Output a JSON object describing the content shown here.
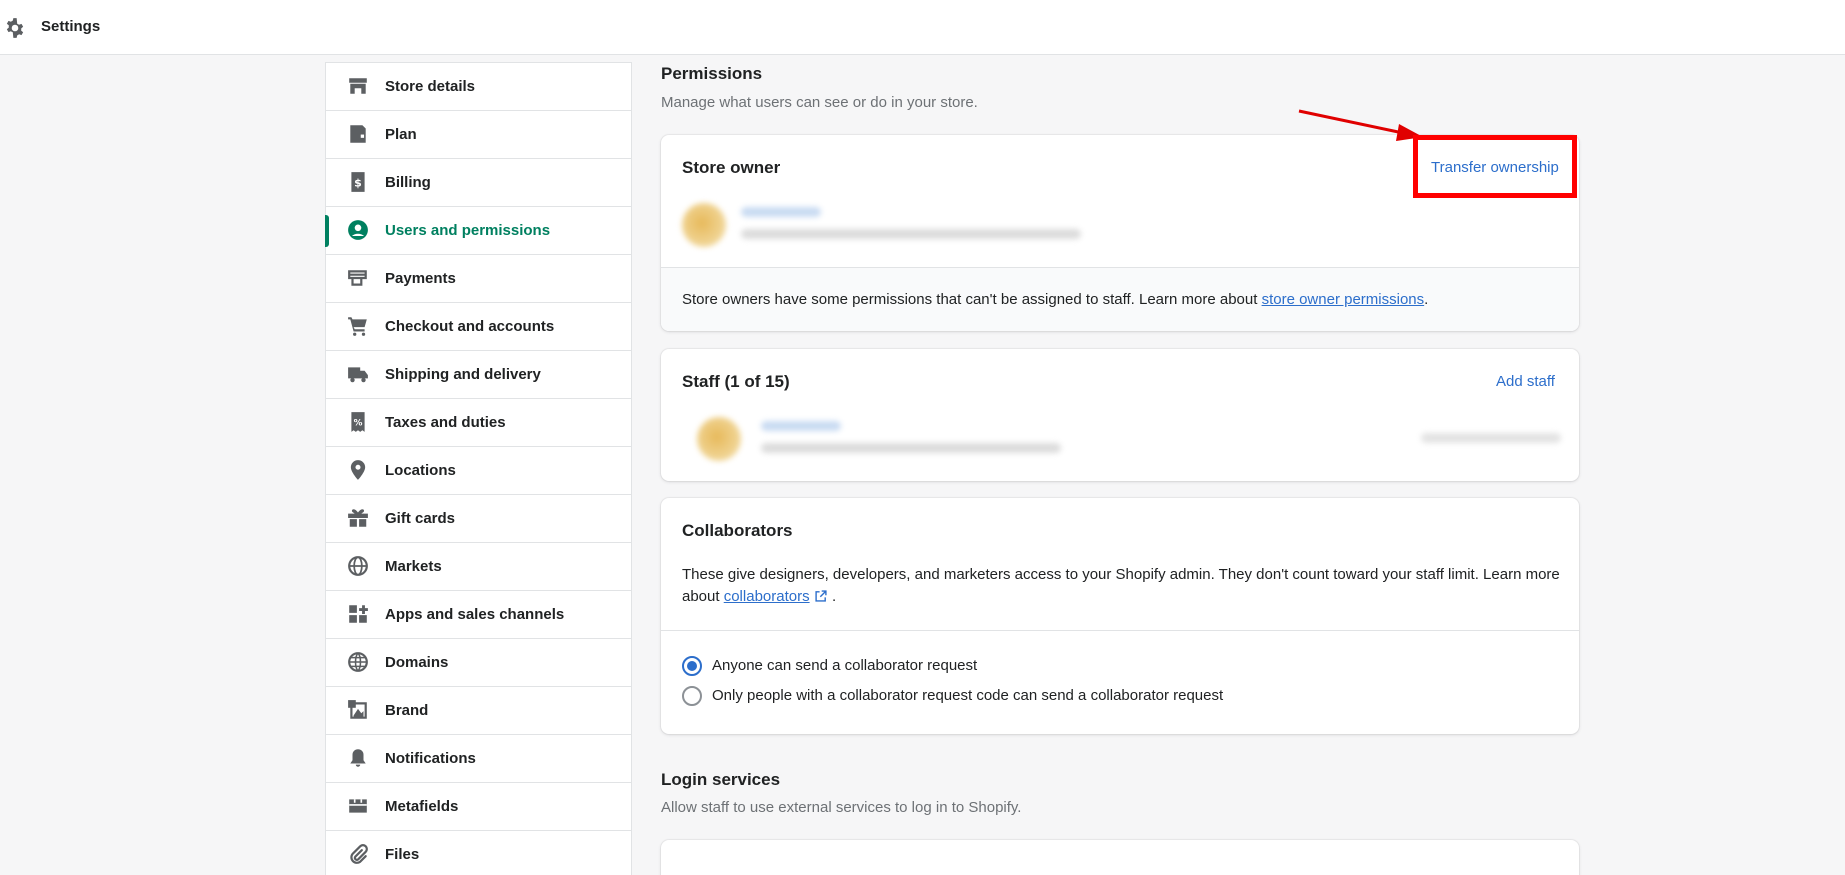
{
  "header": {
    "title": "Settings",
    "icon": "gear-icon"
  },
  "sidebar": {
    "items": [
      {
        "label": "Store details",
        "icon": "store-icon",
        "active": false
      },
      {
        "label": "Plan",
        "icon": "plan-icon",
        "active": false
      },
      {
        "label": "Billing",
        "icon": "billing-icon",
        "active": false
      },
      {
        "label": "Users and permissions",
        "icon": "user-circle-icon",
        "active": true
      },
      {
        "label": "Payments",
        "icon": "payments-icon",
        "active": false
      },
      {
        "label": "Checkout and accounts",
        "icon": "cart-icon",
        "active": false
      },
      {
        "label": "Shipping and delivery",
        "icon": "truck-icon",
        "active": false
      },
      {
        "label": "Taxes and duties",
        "icon": "tax-icon",
        "active": false
      },
      {
        "label": "Locations",
        "icon": "location-pin-icon",
        "active": false
      },
      {
        "label": "Gift cards",
        "icon": "gift-icon",
        "active": false
      },
      {
        "label": "Markets",
        "icon": "globe-markets-icon",
        "active": false
      },
      {
        "label": "Apps and sales channels",
        "icon": "apps-icon",
        "active": false
      },
      {
        "label": "Domains",
        "icon": "globe-icon",
        "active": false
      },
      {
        "label": "Brand",
        "icon": "brand-icon",
        "active": false
      },
      {
        "label": "Notifications",
        "icon": "bell-icon",
        "active": false
      },
      {
        "label": "Metafields",
        "icon": "metafields-icon",
        "active": false
      },
      {
        "label": "Files",
        "icon": "paperclip-icon",
        "active": false
      }
    ]
  },
  "permissions": {
    "title": "Permissions",
    "subtitle": "Manage what users can see or do in your store."
  },
  "store_owner": {
    "title": "Store owner",
    "transfer_label": "Transfer ownership",
    "note_text": "Store owners have some permissions that can't be assigned to staff. Learn more about ",
    "note_link": "store owner permissions",
    "note_end": "."
  },
  "staff": {
    "title": "Staff (1 of 15)",
    "add_label": "Add staff"
  },
  "collaborators": {
    "title": "Collaborators",
    "text": "These give designers, developers, and marketers access to your Shopify admin. They don't count toward your staff limit. Learn more about ",
    "link": "collaborators",
    "text_end": " .",
    "options": [
      {
        "label": "Anyone can send a collaborator request",
        "checked": true
      },
      {
        "label": "Only people with a collaborator request code can send a collaborator request",
        "checked": false
      }
    ]
  },
  "login_services": {
    "title": "Login services",
    "subtitle": "Allow staff to use external services to log in to Shopify."
  },
  "colors": {
    "accent": "#008060",
    "link": "#2c6ecb",
    "annotation": "#ff0000"
  }
}
